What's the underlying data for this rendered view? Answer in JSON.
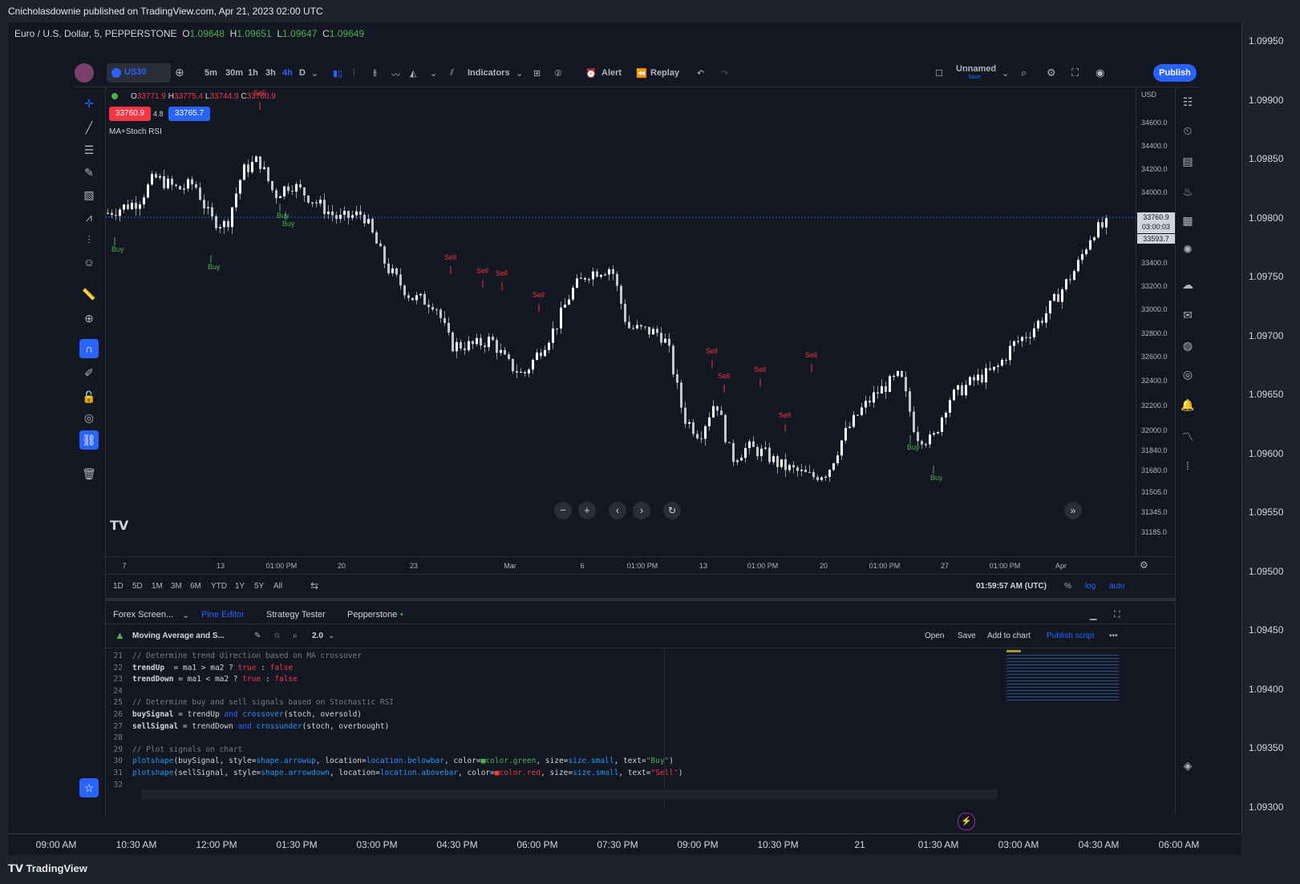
{
  "publication": {
    "text": "Cnicholasdownie published on TradingView.com, Apr 21, 2023 02:00 UTC"
  },
  "outer_chart": {
    "symbol": "Euro / U.S. Dollar, 5, PEPPERSTONE",
    "o_label": "O",
    "o": "1.09648",
    "h_label": "H",
    "h": "1.09651",
    "l_label": "L",
    "l": "1.09647",
    "c_label": "C",
    "c": "1.09649",
    "price_ticks": [
      "1.09950",
      "1.09900",
      "1.09850",
      "1.09800",
      "1.09750",
      "1.09700",
      "1.09650",
      "1.09600",
      "1.09550",
      "1.09500",
      "1.09450",
      "1.09400",
      "1.09350",
      "1.09300"
    ],
    "time_ticks": [
      "09:00 AM",
      "10:30 AM",
      "12:00 PM",
      "01:30 PM",
      "03:00 PM",
      "04:30 PM",
      "06:00 PM",
      "07:30 PM",
      "09:00 PM",
      "10:30 PM",
      "21",
      "01:30 AM",
      "03:00 AM",
      "04:30 AM",
      "06:00 AM"
    ],
    "brand": "TradingView"
  },
  "inner": {
    "symbol": "US30",
    "intervals": [
      "5m",
      "30m",
      "1h",
      "3h",
      "4h",
      "D"
    ],
    "indicators_label": "Indicators",
    "alert_label": "Alert",
    "replay_label": "Replay",
    "layout_name": "Unnamed",
    "layout_sub": "Save",
    "publish_label": "Publish",
    "ohlc": {
      "o_label": "O",
      "o": "33771.9",
      "h_label": "H",
      "h": "33775.4",
      "l_label": "L",
      "l": "33744.9",
      "c_label": "C",
      "c": "33760.9"
    },
    "sell_price": "33760.9",
    "spread": "4.8",
    "buy_price": "33765.7",
    "indicator_name": "MA+Stoch RSI",
    "currency": "USD",
    "price_ticks": [
      "34600.0",
      "34400.0",
      "34200.0",
      "34000.0",
      "33400.0",
      "33200.0",
      "33000.0",
      "32800.0",
      "32600.0",
      "32400.0",
      "32200.0",
      "32000.0",
      "31840.0",
      "31680.0",
      "31505.0",
      "31345.0",
      "31185.0"
    ],
    "price_label_current": "33760.9",
    "price_label_timer": "03:00:03",
    "price_label_ma": "33593.7",
    "time_ticks": [
      "7",
      "13",
      "01:00 PM",
      "20",
      "23",
      "Mar",
      "6",
      "01:00 PM",
      "13",
      "01:00 PM",
      "20",
      "01:00 PM",
      "27",
      "01:00 PM",
      "Apr"
    ],
    "ranges": [
      "1D",
      "5D",
      "1M",
      "3M",
      "6M",
      "YTD",
      "1Y",
      "5Y",
      "All"
    ],
    "clock": "01:59:57 AM (UTC)",
    "pct": "%",
    "log": "log",
    "auto": "auto",
    "tabs": [
      "Forex Screen...",
      "Pine Editor",
      "Strategy Tester",
      "Pepperstone"
    ],
    "script_name": "Moving Average and S...",
    "version": "2.0",
    "script_actions": [
      "Open",
      "Save",
      "Add to chart",
      "Publish script"
    ],
    "signals": {
      "buy": "Buy",
      "sell": "Sell"
    }
  },
  "code_lines": [
    {
      "n": "21",
      "segs": [
        [
          "cm",
          "// Determine trend direction based on MA crossover"
        ]
      ]
    },
    {
      "n": "22",
      "segs": [
        [
          "id",
          "trendUp"
        ],
        [
          "",
          "  = ma1 > ma2 ? "
        ],
        [
          "bo",
          "true"
        ],
        [
          "",
          " : "
        ],
        [
          "bo",
          "false"
        ]
      ]
    },
    {
      "n": "23",
      "segs": [
        [
          "id",
          "trendDown"
        ],
        [
          "",
          " = ma1 < ma2 ? "
        ],
        [
          "bo",
          "true"
        ],
        [
          "",
          " : "
        ],
        [
          "bo",
          "false"
        ]
      ]
    },
    {
      "n": "24",
      "segs": []
    },
    {
      "n": "25",
      "segs": [
        [
          "cm",
          "// Determine buy and sell signals based on Stochastic RSI"
        ]
      ]
    },
    {
      "n": "26",
      "segs": [
        [
          "id",
          "buySignal"
        ],
        [
          "",
          " = trendUp "
        ],
        [
          "kw",
          "and"
        ],
        [
          "",
          " "
        ],
        [
          "fn",
          "crossover"
        ],
        [
          "",
          "(stoch, oversold)"
        ]
      ]
    },
    {
      "n": "27",
      "segs": [
        [
          "id",
          "sellSignal"
        ],
        [
          "",
          " = trendDown "
        ],
        [
          "kw",
          "and"
        ],
        [
          "",
          " "
        ],
        [
          "fn",
          "crossunder"
        ],
        [
          "",
          "(stoch, overbought)"
        ]
      ]
    },
    {
      "n": "28",
      "segs": []
    },
    {
      "n": "29",
      "segs": [
        [
          "cm",
          "// Plot signals on chart"
        ]
      ]
    },
    {
      "n": "30",
      "segs": [
        [
          "fn",
          "plotshape"
        ],
        [
          "",
          "(buySignal, style="
        ],
        [
          "fn",
          "shape.arrowup"
        ],
        [
          "",
          ", location="
        ],
        [
          "fn",
          "location.belowbar"
        ],
        [
          "",
          ", color="
        ],
        [
          "st",
          "■color.green"
        ],
        [
          "",
          ", size="
        ],
        [
          "fn",
          "size.small"
        ],
        [
          "",
          ", text="
        ],
        [
          "st",
          "\"Buy\""
        ],
        [
          "",
          ")"
        ]
      ]
    },
    {
      "n": "31",
      "segs": [
        [
          "fn",
          "plotshape"
        ],
        [
          "",
          "(sellSignal, style="
        ],
        [
          "fn",
          "shape.arrowdown"
        ],
        [
          "",
          ", location="
        ],
        [
          "fn",
          "location.abovebar"
        ],
        [
          "",
          ", color="
        ],
        [
          "bo",
          "■color.red"
        ],
        [
          "",
          ", size="
        ],
        [
          "fn",
          "size.small"
        ],
        [
          "",
          ", text="
        ],
        [
          "bo",
          "\"Sell\""
        ],
        [
          "",
          ")"
        ]
      ]
    },
    {
      "n": "32",
      "segs": []
    }
  ],
  "colors": {
    "up": "#ffffff",
    "down": "#c7c7c7",
    "buy": "#4caf50",
    "sell": "#f23645",
    "accent": "#2962ff"
  },
  "chart_data": {
    "type": "candlestick",
    "y_range": [
      31185,
      34700
    ],
    "close_approx": [
      33760.9
    ],
    "buy_signals": 5,
    "sell_signals": 11
  }
}
